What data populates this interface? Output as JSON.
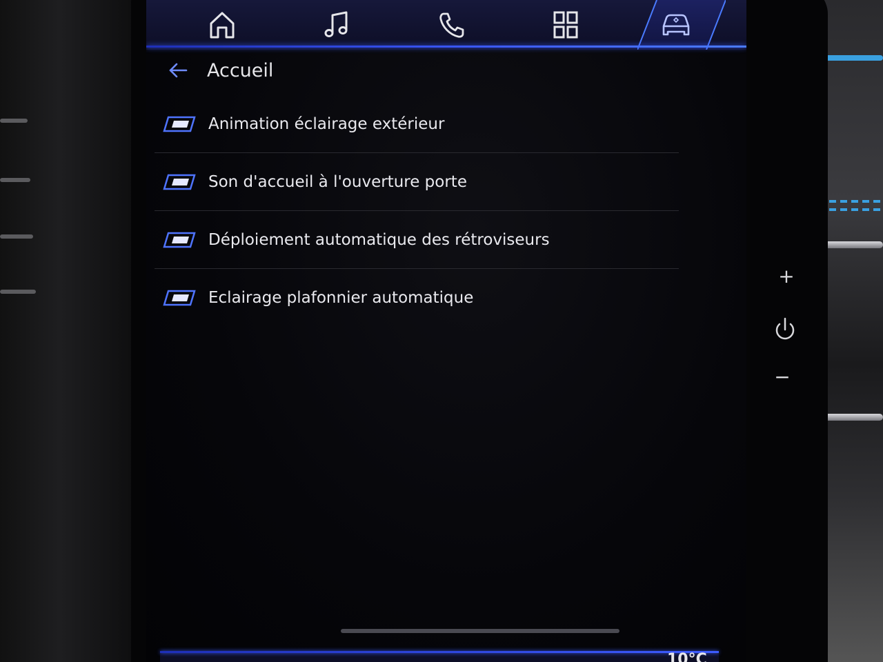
{
  "navbar": {
    "items": [
      {
        "icon": "home-icon",
        "active": false
      },
      {
        "icon": "music-icon",
        "active": false
      },
      {
        "icon": "phone-icon",
        "active": false
      },
      {
        "icon": "apps-grid-icon",
        "active": false
      },
      {
        "icon": "car-icon",
        "active": true
      }
    ],
    "accent_color": "#3d5cff"
  },
  "header": {
    "back_icon": "arrow-left-icon",
    "title": "Accueil"
  },
  "menu": {
    "items": [
      {
        "label": "Animation éclairage extérieur",
        "icon": "parallelogram-icon"
      },
      {
        "label": "Son d'accueil à l'ouverture porte",
        "icon": "parallelogram-icon"
      },
      {
        "label": "Déploiement automatique des rétroviseurs",
        "icon": "parallelogram-icon"
      },
      {
        "label": "Eclairage plafonnier automatique",
        "icon": "parallelogram-icon"
      }
    ]
  },
  "status": {
    "temperature": "10°C"
  },
  "hardware_buttons": {
    "plus": "+",
    "minus": "−"
  }
}
